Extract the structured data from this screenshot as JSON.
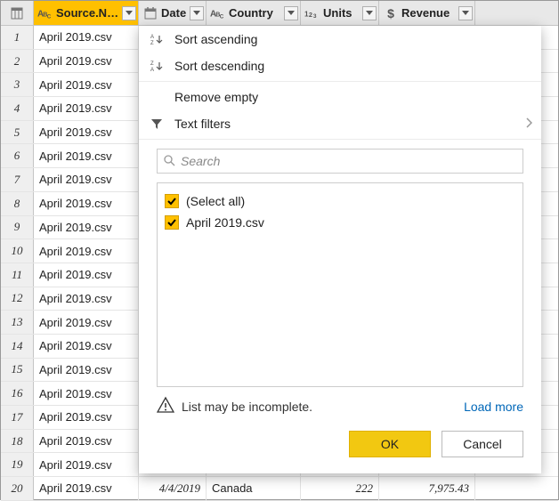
{
  "columns": {
    "source": {
      "label": "Source.Name",
      "type": "text"
    },
    "date": {
      "label": "Date",
      "type": "date"
    },
    "country": {
      "label": "Country",
      "type": "text"
    },
    "units": {
      "label": "Units",
      "type": "int"
    },
    "revenue": {
      "label": "Revenue",
      "type": "currency"
    }
  },
  "rows": [
    {
      "n": "1",
      "source": "April 2019.csv"
    },
    {
      "n": "2",
      "source": "April 2019.csv"
    },
    {
      "n": "3",
      "source": "April 2019.csv"
    },
    {
      "n": "4",
      "source": "April 2019.csv"
    },
    {
      "n": "5",
      "source": "April 2019.csv"
    },
    {
      "n": "6",
      "source": "April 2019.csv"
    },
    {
      "n": "7",
      "source": "April 2019.csv"
    },
    {
      "n": "8",
      "source": "April 2019.csv"
    },
    {
      "n": "9",
      "source": "April 2019.csv"
    },
    {
      "n": "10",
      "source": "April 2019.csv"
    },
    {
      "n": "11",
      "source": "April 2019.csv"
    },
    {
      "n": "12",
      "source": "April 2019.csv"
    },
    {
      "n": "13",
      "source": "April 2019.csv"
    },
    {
      "n": "14",
      "source": "April 2019.csv"
    },
    {
      "n": "15",
      "source": "April 2019.csv"
    },
    {
      "n": "16",
      "source": "April 2019.csv"
    },
    {
      "n": "17",
      "source": "April 2019.csv"
    },
    {
      "n": "18",
      "source": "April 2019.csv"
    },
    {
      "n": "19",
      "source": "April 2019.csv"
    },
    {
      "n": "20",
      "source": "April 2019.csv",
      "date": "4/4/2019",
      "country": "Canada",
      "units": "222",
      "revenue": "7,975.43"
    }
  ],
  "filter": {
    "sort_asc": "Sort ascending",
    "sort_desc": "Sort descending",
    "remove_empty": "Remove empty",
    "text_filters": "Text filters",
    "search_placeholder": "Search",
    "select_all": "(Select all)",
    "items": [
      {
        "label": "April 2019.csv",
        "checked": true
      }
    ],
    "incomplete_warning": "List may be incomplete.",
    "load_more": "Load more",
    "ok": "OK",
    "cancel": "Cancel"
  }
}
